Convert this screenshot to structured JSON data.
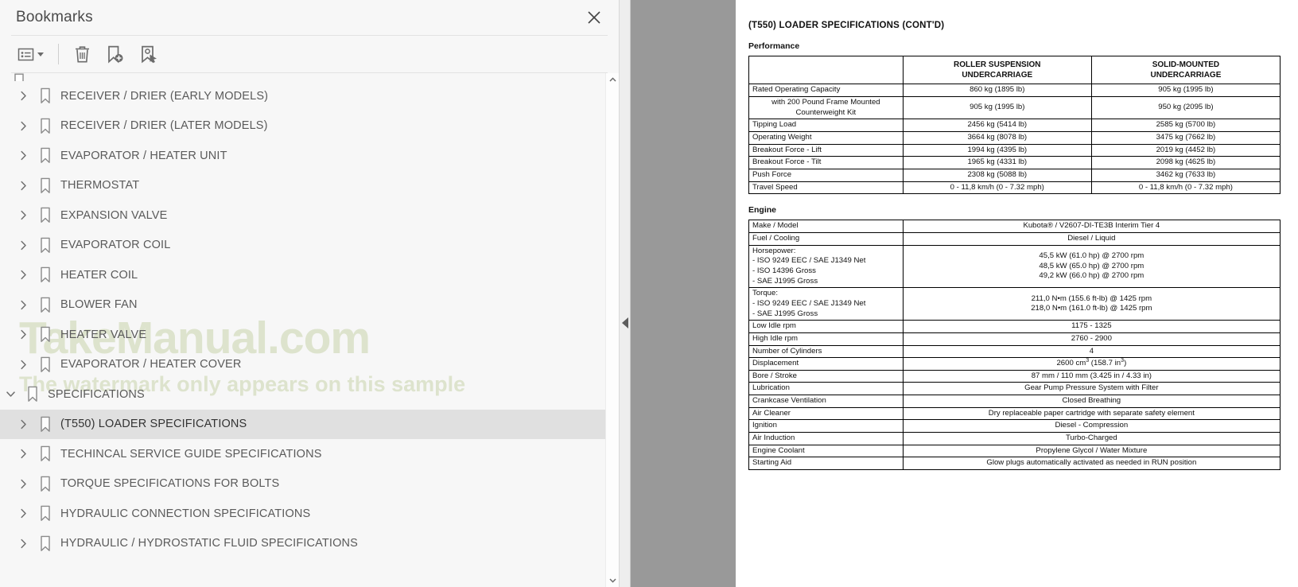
{
  "panel": {
    "title": "Bookmarks",
    "close_icon": "close-icon",
    "toolbar": {
      "options_icon": "list-options-icon",
      "caret_icon": "chevron-down-icon",
      "delete_icon": "trash-icon",
      "new_bookmark_icon": "add-bookmark-icon",
      "select_bookmark_icon": "bookmark-cursor-icon"
    },
    "watermark": {
      "line1": "TakeManual.com",
      "line2": "The watermark only appears on this sample",
      "color": "#dde3cd"
    },
    "selection_color": "#e0e0e0",
    "items": [
      {
        "label": "RECEIVER / DRIER (EARLY MODELS)",
        "level": 1,
        "expanded": false,
        "selected": false
      },
      {
        "label": "RECEIVER / DRIER (LATER MODELS)",
        "level": 1,
        "expanded": false,
        "selected": false
      },
      {
        "label": "EVAPORATOR / HEATER UNIT",
        "level": 1,
        "expanded": false,
        "selected": false
      },
      {
        "label": "THERMOSTAT",
        "level": 1,
        "expanded": false,
        "selected": false
      },
      {
        "label": "EXPANSION VALVE",
        "level": 1,
        "expanded": false,
        "selected": false
      },
      {
        "label": "EVAPORATOR COIL",
        "level": 1,
        "expanded": false,
        "selected": false
      },
      {
        "label": "HEATER COIL",
        "level": 1,
        "expanded": false,
        "selected": false
      },
      {
        "label": "BLOWER FAN",
        "level": 1,
        "expanded": false,
        "selected": false
      },
      {
        "label": "HEATER VALVE",
        "level": 1,
        "expanded": false,
        "selected": false
      },
      {
        "label": "EVAPORATOR / HEATER COVER",
        "level": 1,
        "expanded": false,
        "selected": false
      },
      {
        "label": "SPECIFICATIONS",
        "level": 0,
        "expanded": true,
        "selected": false
      },
      {
        "label": "(T550) LOADER SPECIFICATIONS",
        "level": 1,
        "expanded": false,
        "selected": true
      },
      {
        "label": "TECHINCAL SERVICE GUIDE SPECIFICATIONS",
        "level": 1,
        "expanded": false,
        "selected": false
      },
      {
        "label": "TORQUE SPECIFICATIONS FOR BOLTS",
        "level": 1,
        "expanded": false,
        "selected": false
      },
      {
        "label": "HYDRAULIC CONNECTION SPECIFICATIONS",
        "level": 1,
        "expanded": false,
        "selected": false
      },
      {
        "label": "HYDRAULIC / HYDROSTATIC FLUID SPECIFICATIONS",
        "level": 1,
        "expanded": false,
        "selected": false
      }
    ]
  },
  "splitter": {
    "collapse_icon": "triangle-left-icon"
  },
  "document": {
    "title": "(T550) LOADER SPECIFICATIONS (CONT'D)",
    "performance": {
      "heading": "Performance",
      "columns": [
        "",
        "ROLLER SUSPENSION\nUNDERCARRIAGE",
        "SOLID-MOUNTED\nUNDERCARRIAGE"
      ],
      "rows": [
        {
          "label": "Rated Operating Capacity",
          "center_label": false,
          "values": [
            "860 kg (1895 lb)",
            "905 kg (1995 lb)"
          ]
        },
        {
          "label": "with 200 Pound Frame Mounted\nCounterweight Kit",
          "center_label": true,
          "values": [
            "905 kg (1995 lb)",
            "950 kg (2095 lb)"
          ]
        },
        {
          "label": "Tipping Load",
          "center_label": false,
          "values": [
            "2456 kg (5414 lb)",
            "2585 kg (5700 lb)"
          ]
        },
        {
          "label": "Operating Weight",
          "center_label": false,
          "values": [
            "3664 kg (8078 lb)",
            "3475 kg (7662 lb)"
          ]
        },
        {
          "label": "Breakout Force - Lift",
          "center_label": false,
          "values": [
            "1994 kg (4395 lb)",
            "2019 kg (4452 lb)"
          ]
        },
        {
          "label": "Breakout Force - Tilt",
          "center_label": false,
          "values": [
            "1965 kg (4331 lb)",
            "2098 kg (4625 lb)"
          ]
        },
        {
          "label": "Push Force",
          "center_label": false,
          "values": [
            "2308 kg (5088 lb)",
            "3462 kg (7633 lb)"
          ]
        },
        {
          "label": "Travel Speed",
          "center_label": false,
          "values": [
            "0 - 11,8 km/h (0 - 7.32 mph)",
            "0 - 11,8 km/h (0 - 7.32 mph)"
          ]
        }
      ]
    },
    "engine": {
      "heading": "Engine",
      "rows": [
        {
          "label": "Make / Model",
          "value": "Kubota® / V2607-DI-TE3B Interim Tier 4"
        },
        {
          "label": "Fuel / Cooling",
          "value": "Diesel / Liquid"
        },
        {
          "label": "Horsepower:\n   - ISO 9249 EEC / SAE J1349 Net\n   - ISO 14396 Gross\n   - SAE J1995 Gross",
          "value": "45,5 kW (61.0 hp) @ 2700 rpm\n48,5 kW (65.0 hp) @ 2700 rpm\n49,2 kW (66.0 hp) @ 2700 rpm"
        },
        {
          "label": "Torque:\n   - ISO 9249 EEC / SAE J1349 Net\n   - SAE J1995 Gross",
          "value": "211,0 N•m (155.6 ft-lb) @ 1425 rpm\n218,0 N•m (161.0 ft-lb) @ 1425 rpm"
        },
        {
          "label": "Low Idle rpm",
          "value": "1175 - 1325"
        },
        {
          "label": "High Idle rpm",
          "value": "2760 - 2900"
        },
        {
          "label": "Number of Cylinders",
          "value": "4"
        },
        {
          "label": "Displacement",
          "value": "2600 cm³ (158.7 in³)"
        },
        {
          "label": "Bore / Stroke",
          "value": "87 mm / 110 mm (3.425 in / 4.33 in)"
        },
        {
          "label": "Lubrication",
          "value": "Gear Pump Pressure System with Filter"
        },
        {
          "label": "Crankcase Ventilation",
          "value": "Closed Breathing"
        },
        {
          "label": "Air Cleaner",
          "value": "Dry replaceable paper cartridge with separate safety element"
        },
        {
          "label": "Ignition",
          "value": "Diesel - Compression"
        },
        {
          "label": "Air Induction",
          "value": "Turbo-Charged"
        },
        {
          "label": "Engine Coolant",
          "value": "Propylene Glycol / Water Mixture"
        },
        {
          "label": "Starting Aid",
          "value": "Glow plugs automatically activated as needed in RUN position"
        }
      ]
    }
  }
}
